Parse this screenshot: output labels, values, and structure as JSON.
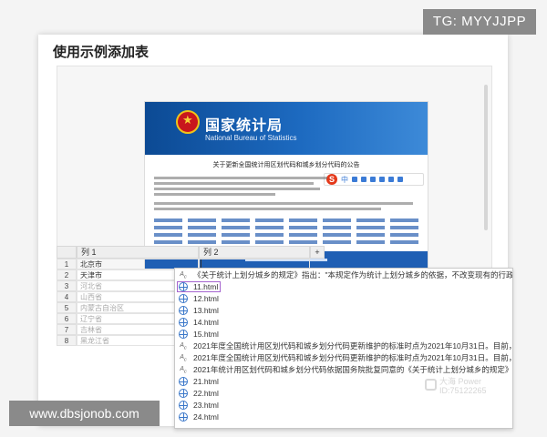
{
  "dialog": {
    "title": "使用示例添加表"
  },
  "website": {
    "name_cn": "国家统计局",
    "name_en": "National Bureau of Statistics",
    "notice_title": "关于更新全国统计用区划代码和城乡划分代码的公告",
    "ime_label": "中"
  },
  "table": {
    "columns": [
      "列 1",
      "列 2",
      "+"
    ],
    "rows": [
      {
        "num": "1",
        "col1": "北京市"
      },
      {
        "num": "2",
        "col1": "天津市"
      },
      {
        "num": "3",
        "col1": "河北省"
      },
      {
        "num": "4",
        "col1": "山西省"
      },
      {
        "num": "5",
        "col1": "内蒙古自治区"
      },
      {
        "num": "6",
        "col1": "辽宁省"
      },
      {
        "num": "7",
        "col1": "吉林省"
      },
      {
        "num": "8",
        "col1": "黑龙江省"
      }
    ]
  },
  "autocomplete": {
    "items": [
      {
        "icon": "abc",
        "text": "《关于统计上划分城乡的规定》指出：\"本规定作为统计上划分城乡的依据，不改变现有的行政区划、隶属关"
      },
      {
        "icon": "globe",
        "text": "11.html"
      },
      {
        "icon": "globe",
        "text": "12.html"
      },
      {
        "icon": "globe",
        "text": "13.html"
      },
      {
        "icon": "globe",
        "text": "14.html"
      },
      {
        "icon": "globe",
        "text": "15.html"
      },
      {
        "icon": "abc",
        "text": "2021年度全国统计用区划代码和城乡划分代码更新维护的标准时点为2021年10月31日。目前，已完成更新"
      },
      {
        "icon": "abc",
        "text": "2021年度全国统计用区划代码和城乡划分代码更新维护的标准时点为2021年10月31日。目前，已完成更新"
      },
      {
        "icon": "abc",
        "text": "2021年统计用区划代码和城乡划分代码依据国务院批复同意的《关于统计上划分城乡的规定》（国函〔200"
      },
      {
        "icon": "globe",
        "text": "21.html"
      },
      {
        "icon": "globe",
        "text": "22.html"
      },
      {
        "icon": "globe",
        "text": "23.html"
      },
      {
        "icon": "globe",
        "text": "24.html"
      }
    ]
  },
  "overlays": {
    "tg": "TG: MYYJJPP",
    "url": "www.dbsjonob.com",
    "watermark_line1": "大海 Power",
    "watermark_line2": "ID:75122265"
  }
}
